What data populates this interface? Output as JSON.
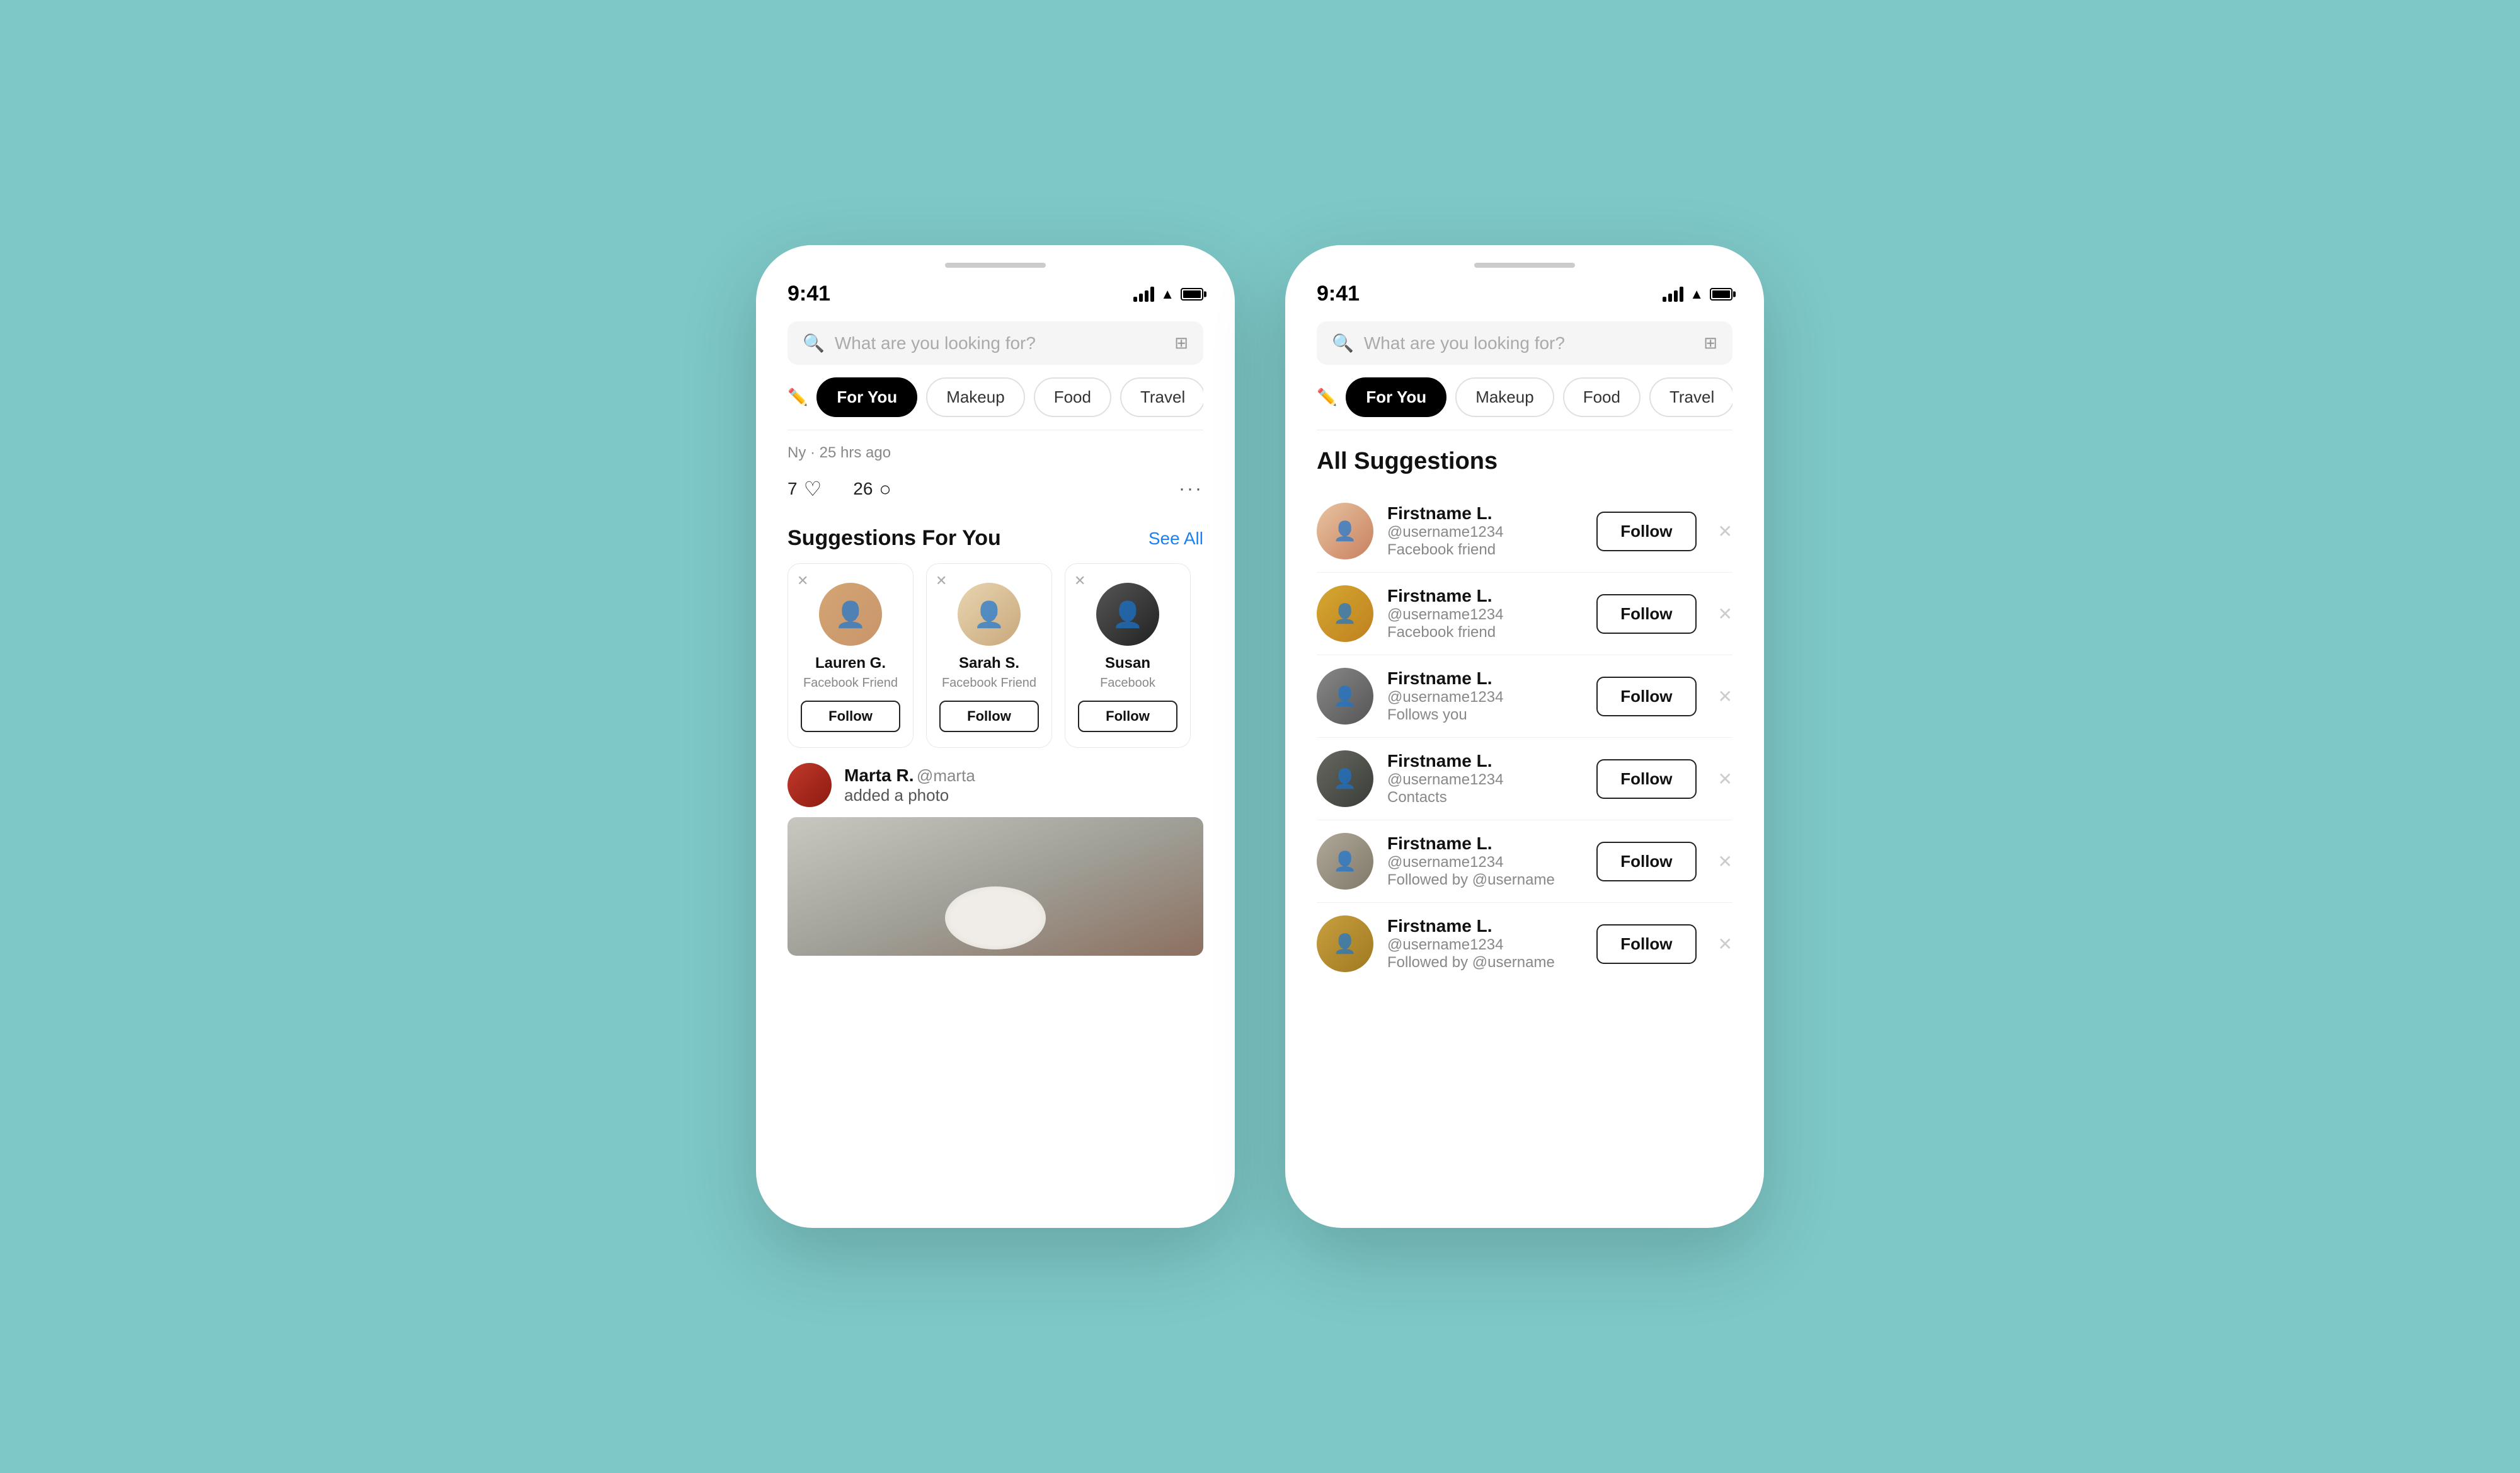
{
  "background": "#7ec8c8",
  "phone_left": {
    "status": {
      "time": "9:41"
    },
    "search": {
      "placeholder": "What are you looking for?"
    },
    "tabs": [
      {
        "label": "For You",
        "active": true
      },
      {
        "label": "Makeup",
        "active": false
      },
      {
        "label": "Food",
        "active": false
      },
      {
        "label": "Travel",
        "active": false
      }
    ],
    "post_meta": "Ny · 25 hrs ago",
    "interactions": {
      "likes": "7",
      "comments": "26"
    },
    "suggestions_section": {
      "title": "Suggestions For You",
      "see_all": "See All",
      "cards": [
        {
          "name": "Lauren G.",
          "subtitle": "Facebook Friend",
          "follow_label": "Follow"
        },
        {
          "name": "Sarah S.",
          "subtitle": "Facebook Friend",
          "follow_label": "Follow"
        },
        {
          "name": "Susan",
          "subtitle": "Facebook",
          "follow_label": "Follow"
        }
      ]
    },
    "marta_post": {
      "name": "Marta R.",
      "handle": "@marta",
      "action": "added a photo"
    }
  },
  "phone_right": {
    "status": {
      "time": "9:41"
    },
    "search": {
      "placeholder": "What are you looking for?"
    },
    "tabs": [
      {
        "label": "For You",
        "active": true
      },
      {
        "label": "Makeup",
        "active": false
      },
      {
        "label": "Food",
        "active": false
      },
      {
        "label": "Travel",
        "active": false
      }
    ],
    "all_suggestions": {
      "title": "All Suggestions",
      "items": [
        {
          "name": "Firstname L.",
          "handle": "@username1234",
          "relation": "Facebook friend",
          "follow_label": "Follow"
        },
        {
          "name": "Firstname L.",
          "handle": "@username1234",
          "relation": "Facebook friend",
          "follow_label": "Follow"
        },
        {
          "name": "Firstname L.",
          "handle": "@username1234",
          "relation": "Follows you",
          "follow_label": "Follow"
        },
        {
          "name": "Firstname L.",
          "handle": "@username1234",
          "relation": "Contacts",
          "follow_label": "Follow"
        },
        {
          "name": "Firstname L.",
          "handle": "@username1234",
          "relation": "Followed by @username",
          "follow_label": "Follow"
        },
        {
          "name": "Firstname L.",
          "handle": "@username1234",
          "relation": "Followed by @username",
          "follow_label": "Follow"
        }
      ]
    }
  }
}
